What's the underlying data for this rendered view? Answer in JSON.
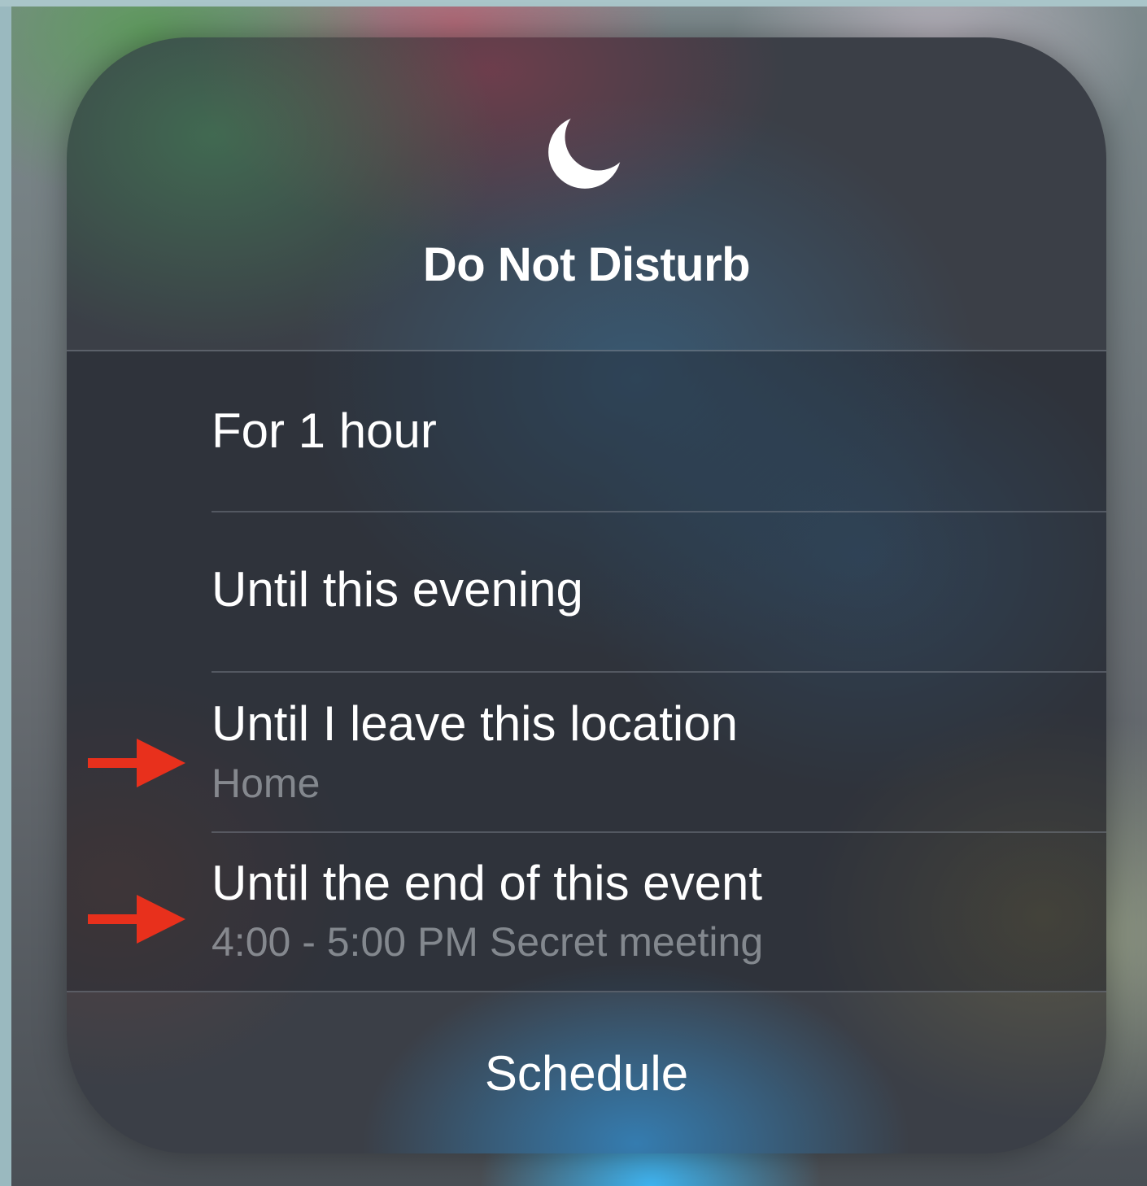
{
  "panel": {
    "title": "Do Not Disturb",
    "icon": "moon-icon"
  },
  "options": [
    {
      "title": "For 1 hour",
      "subtitle": ""
    },
    {
      "title": "Until this evening",
      "subtitle": ""
    },
    {
      "title": "Until I leave this location",
      "subtitle": "Home"
    },
    {
      "title": "Until the end of this event",
      "subtitle": "4:00 - 5:00 PM Secret meeting"
    }
  ],
  "footer": {
    "schedule_label": "Schedule"
  },
  "annotations": {
    "arrow_color": "#e8301c",
    "arrow_icon": "arrow-right-icon"
  }
}
